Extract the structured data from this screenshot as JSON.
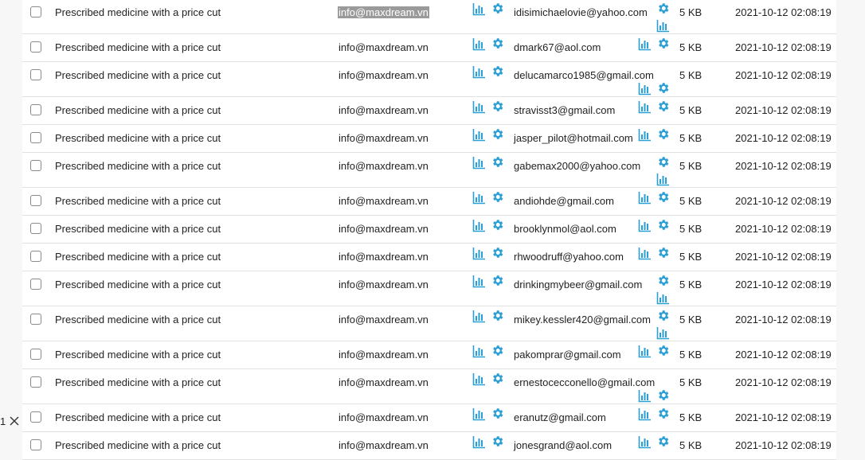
{
  "colors": {
    "icon": "#2a9fd6",
    "row_border": "#e2e2e2",
    "highlight": "#9a9a9a"
  },
  "pager": {
    "page": "1",
    "close_icon": "close-icon"
  },
  "rows": [
    {
      "subject": "Prescribed medicine with a price cut",
      "from": "info@maxdream.vn",
      "to": "idisimichaelovie@yahoo.com",
      "size": "5 KB",
      "date": "2021-10-12 02:08:19",
      "wrap": true,
      "highlight": true
    },
    {
      "subject": "Prescribed medicine with a price cut",
      "from": "info@maxdream.vn",
      "to": "dmark67@aol.com",
      "size": "5 KB",
      "date": "2021-10-12 02:08:19",
      "wrap": false
    },
    {
      "subject": "Prescribed medicine with a price cut",
      "from": "info@maxdream.vn",
      "to": "delucamarco1985@gmail.com",
      "size": "5 KB",
      "date": "2021-10-12 02:08:19",
      "wrap": "both"
    },
    {
      "subject": "Prescribed medicine with a price cut",
      "from": "info@maxdream.vn",
      "to": "stravisst3@gmail.com",
      "size": "5 KB",
      "date": "2021-10-12 02:08:19",
      "wrap": false
    },
    {
      "subject": "Prescribed medicine with a price cut",
      "from": "info@maxdream.vn",
      "to": "jasper_pilot@hotmail.com",
      "size": "5 KB",
      "date": "2021-10-12 02:08:19",
      "wrap": false
    },
    {
      "subject": "Prescribed medicine with a price cut",
      "from": "info@maxdream.vn",
      "to": "gabemax2000@yahoo.com",
      "size": "5 KB",
      "date": "2021-10-12 02:08:19",
      "wrap": true
    },
    {
      "subject": "Prescribed medicine with a price cut",
      "from": "info@maxdream.vn",
      "to": "andiohde@gmail.com",
      "size": "5 KB",
      "date": "2021-10-12 02:08:19",
      "wrap": false
    },
    {
      "subject": "Prescribed medicine with a price cut",
      "from": "info@maxdream.vn",
      "to": "brooklynmol@aol.com",
      "size": "5 KB",
      "date": "2021-10-12 02:08:19",
      "wrap": false
    },
    {
      "subject": "Prescribed medicine with a price cut",
      "from": "info@maxdream.vn",
      "to": "rhwoodruff@yahoo.com",
      "size": "5 KB",
      "date": "2021-10-12 02:08:19",
      "wrap": false
    },
    {
      "subject": "Prescribed medicine with a price cut",
      "from": "info@maxdream.vn",
      "to": "drinkingmybeer@gmail.com",
      "size": "5 KB",
      "date": "2021-10-12 02:08:19",
      "wrap": true
    },
    {
      "subject": "Prescribed medicine with a price cut",
      "from": "info@maxdream.vn",
      "to": "mikey.kessler420@gmail.com",
      "size": "5 KB",
      "date": "2021-10-12 02:08:19",
      "wrap": true
    },
    {
      "subject": "Prescribed medicine with a price cut",
      "from": "info@maxdream.vn",
      "to": "pakomprar@gmail.com",
      "size": "5 KB",
      "date": "2021-10-12 02:08:19",
      "wrap": false
    },
    {
      "subject": "Prescribed medicine with a price cut",
      "from": "info@maxdream.vn",
      "to": "ernestocecconello@gmail.com",
      "size": "5 KB",
      "date": "2021-10-12 02:08:19",
      "wrap": "both"
    },
    {
      "subject": "Prescribed medicine with a price cut",
      "from": "info@maxdream.vn",
      "to": "eranutz@gmail.com",
      "size": "5 KB",
      "date": "2021-10-12 02:08:19",
      "wrap": false
    },
    {
      "subject": "Prescribed medicine with a price cut",
      "from": "info@maxdream.vn",
      "to": "jonesgrand@aol.com",
      "size": "5 KB",
      "date": "2021-10-12 02:08:19",
      "wrap": false
    }
  ]
}
